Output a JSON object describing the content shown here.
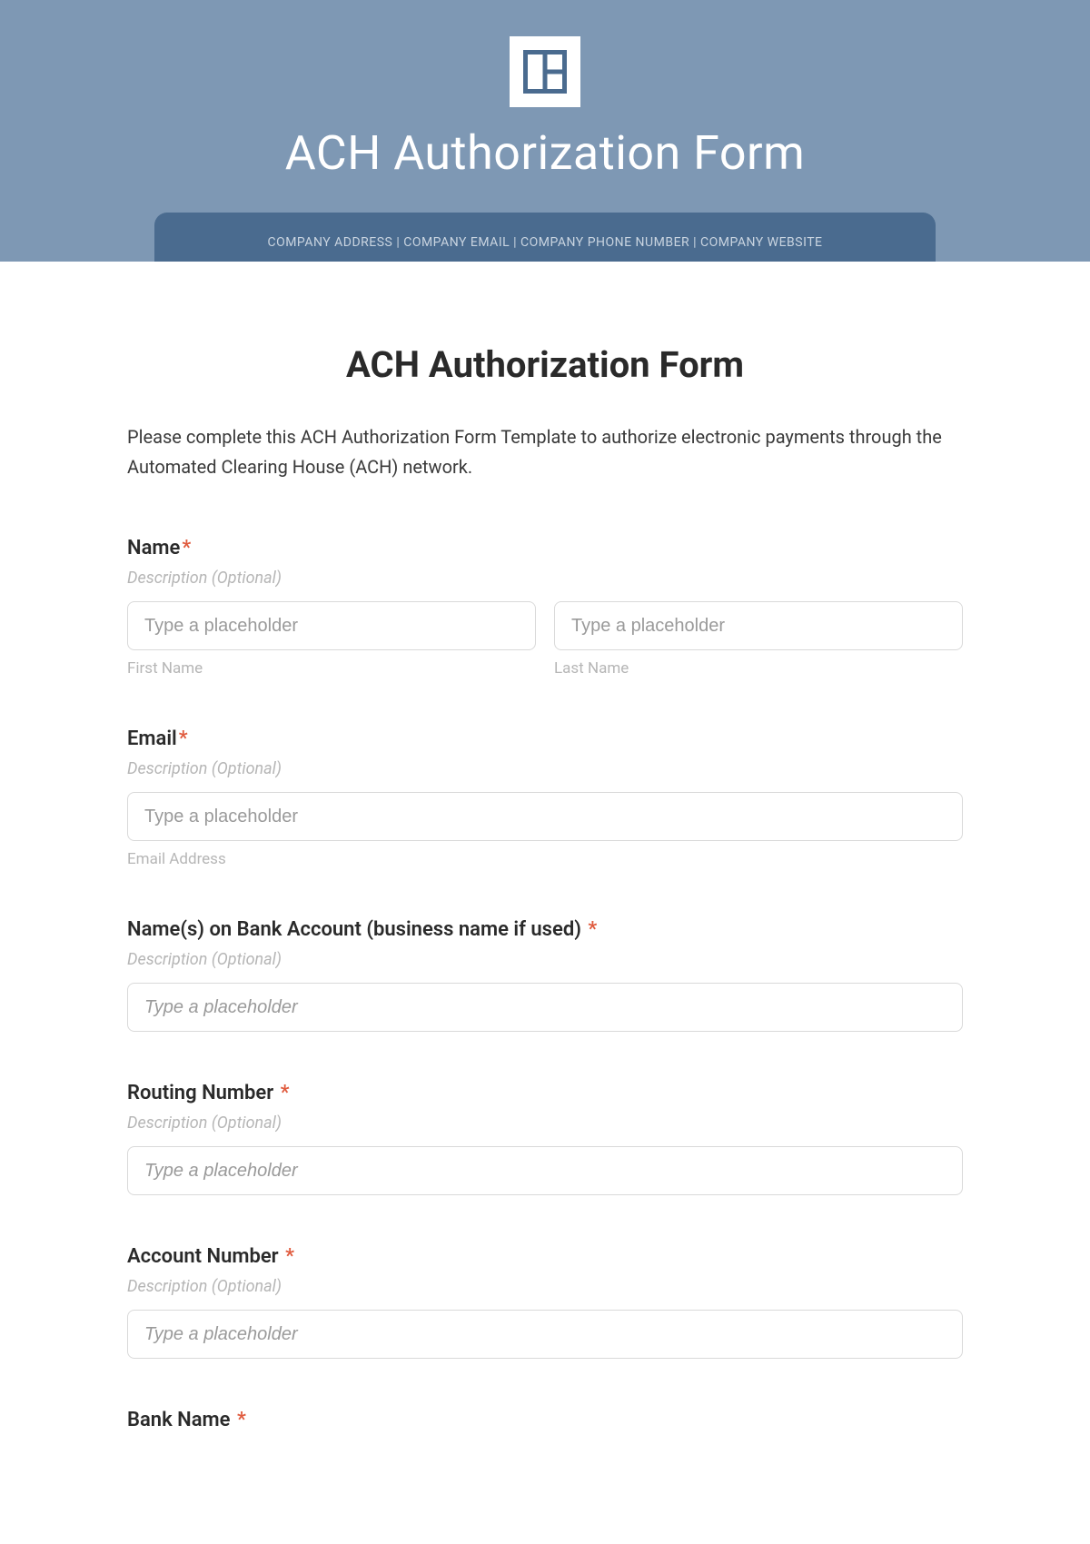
{
  "banner": {
    "title": "ACH Authorization Form",
    "company_bar": "COMPANY ADDRESS | COMPANY EMAIL | COMPANY PHONE NUMBER | COMPANY WEBSITE"
  },
  "form": {
    "heading": "ACH Authorization Form",
    "intro": "Please complete this ACH Authorization Form Template to authorize electronic payments through the Automated Clearing House (ACH) network.",
    "desc_placeholder": "Description (Optional)",
    "required_mark": "*"
  },
  "fields": {
    "name": {
      "label": "Name",
      "first_placeholder": "Type a placeholder",
      "first_sublabel": "First Name",
      "last_placeholder": "Type a placeholder",
      "last_sublabel": "Last Name"
    },
    "email": {
      "label": "Email",
      "placeholder": "Type a placeholder",
      "sublabel": "Email Address"
    },
    "account_name": {
      "label": "Name(s) on Bank Account (business name if used)",
      "placeholder": "Type a placeholder"
    },
    "routing": {
      "label": "Routing Number",
      "placeholder": "Type a placeholder"
    },
    "account_number": {
      "label": "Account Number",
      "placeholder": "Type a placeholder"
    },
    "bank_name": {
      "label": "Bank Name"
    }
  }
}
